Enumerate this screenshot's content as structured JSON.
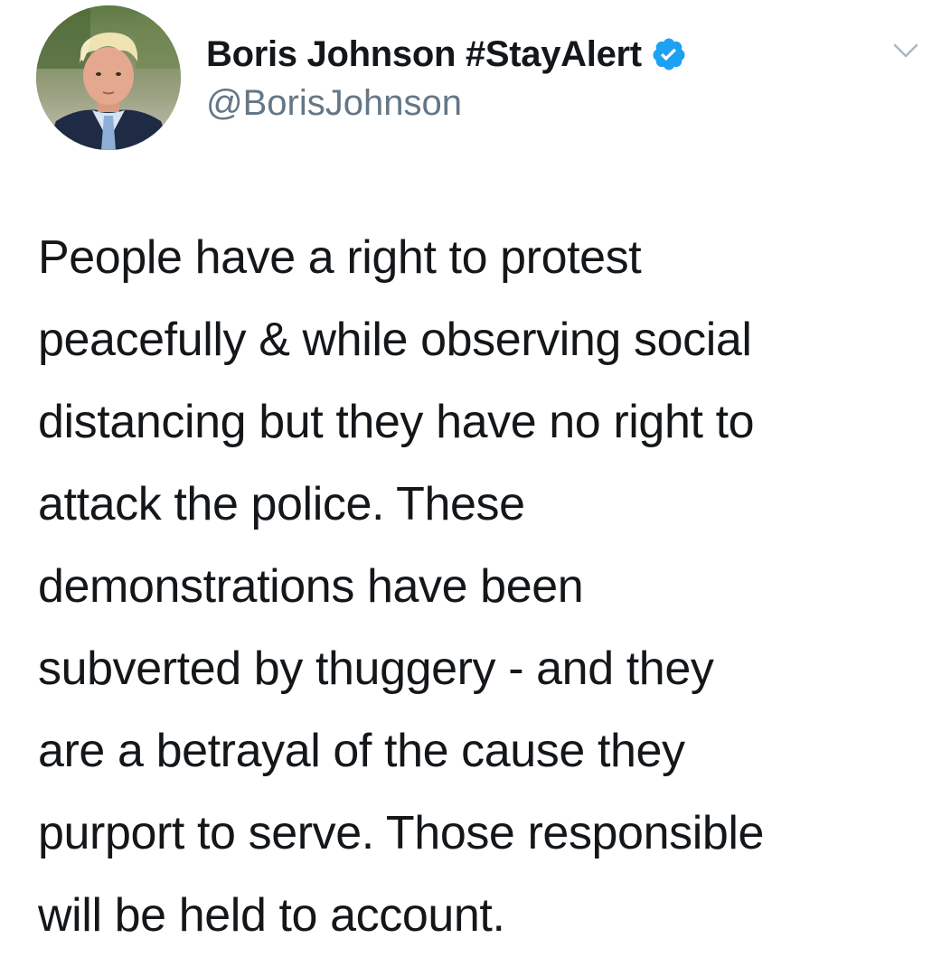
{
  "user": {
    "display_name": "Boris Johnson #StayAlert",
    "handle": "@BorisJohnson",
    "verified": true,
    "verified_icon": "verified-badge-icon",
    "verified_color": "#1da1f2"
  },
  "menu": {
    "icon": "chevron-down-icon"
  },
  "tweet": {
    "lines": [
      "People have a right to protest",
      "peacefully & while observing social",
      "distancing but they have no right to",
      "attack the police. These",
      "demonstrations have been",
      "subverted by thuggery - and they",
      "are a betrayal of the cause they",
      "purport to serve. Those responsible",
      "will be held to account."
    ]
  }
}
